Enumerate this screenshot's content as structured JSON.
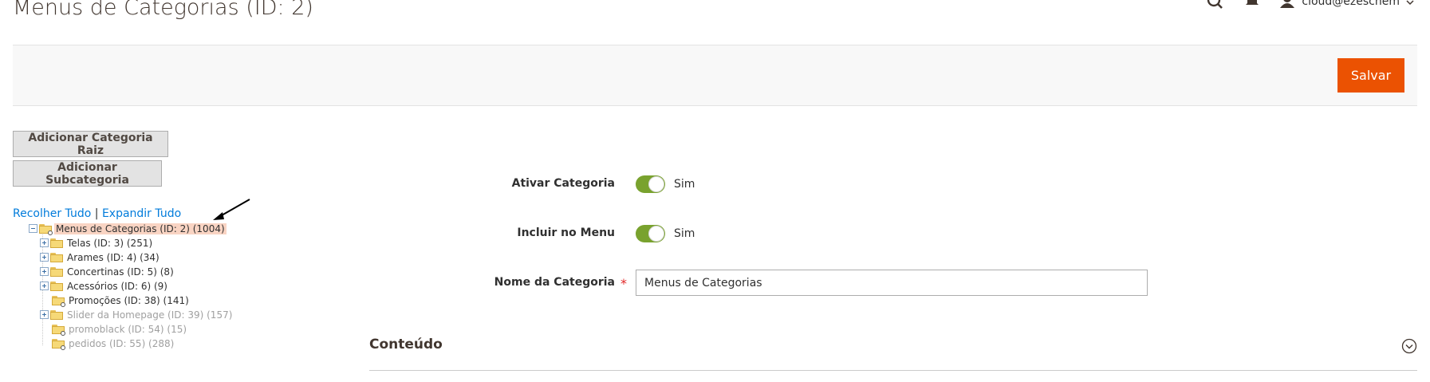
{
  "page": {
    "title": "Menus de Categorias (ID: 2)"
  },
  "header": {
    "user_name": "cloud@ezeschem"
  },
  "action_bar": {
    "save_label": "Salvar"
  },
  "buttons": {
    "add_root": "Adicionar Categoria Raiz",
    "add_sub": "Adicionar Subcategoria"
  },
  "tree_controls": {
    "collapse_all": "Recolher Tudo",
    "separator": "|",
    "expand_all": "Expandir Tudo"
  },
  "tree": {
    "nodes": [
      {
        "label": "Menus de Categorias (ID: 2) (1004)"
      },
      {
        "label": "Telas (ID: 3) (251)"
      },
      {
        "label": "Arames (ID: 4) (34)"
      },
      {
        "label": "Concertinas (ID: 5) (8)"
      },
      {
        "label": "Acessórios (ID: 6) (9)"
      },
      {
        "label": "Promoções (ID: 38) (141)"
      },
      {
        "label": "Slider da Homepage (ID: 39) (157)"
      },
      {
        "label": "promoblack (ID: 54) (15)"
      },
      {
        "label": "pedidos (ID: 55) (288)"
      }
    ]
  },
  "form": {
    "enable_category": {
      "label": "Ativar Categoria",
      "value_text": "Sim"
    },
    "include_in_menu": {
      "label": "Incluir no Menu",
      "value_text": "Sim"
    },
    "category_name": {
      "label": "Nome da Categoria",
      "required_mark": "*",
      "value": "Menus de Categorias"
    }
  },
  "sections": {
    "content_title": "Conteúdo"
  },
  "colors": {
    "accent": "#eb5202",
    "toggle_on": "#79a22e",
    "link": "#007bdb",
    "selected_node": "#f9d4c3"
  }
}
